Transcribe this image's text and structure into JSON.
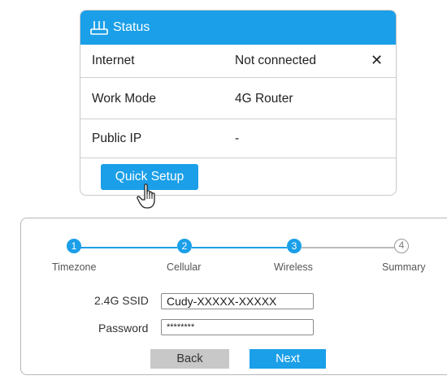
{
  "status": {
    "title": "Status",
    "rows": [
      {
        "label": "Internet",
        "value": "Not connected",
        "indicator": "✕"
      },
      {
        "label": "Work Mode",
        "value": "4G Router"
      },
      {
        "label": "Public IP",
        "value": "-"
      }
    ],
    "quick_setup_label": "Quick Setup"
  },
  "wizard": {
    "steps": [
      {
        "number": "1",
        "label": "Timezone",
        "state": "done"
      },
      {
        "number": "2",
        "label": "Cellular",
        "state": "done"
      },
      {
        "number": "3",
        "label": "Wireless",
        "state": "current"
      },
      {
        "number": "4",
        "label": "Summary",
        "state": "pending"
      }
    ],
    "ssid_label": "2.4G SSID",
    "ssid_value": "Cudy-XXXXX-XXXXX",
    "password_label": "Password",
    "password_value": "********",
    "back_label": "Back",
    "next_label": "Next"
  },
  "colors": {
    "accent": "#1a9fe8",
    "inactive": "#bdbdbd",
    "button_gray": "#c8c8c8"
  },
  "icons": {
    "router": "router-icon",
    "cursor": "hand-pointer-icon",
    "close": "close-icon"
  }
}
